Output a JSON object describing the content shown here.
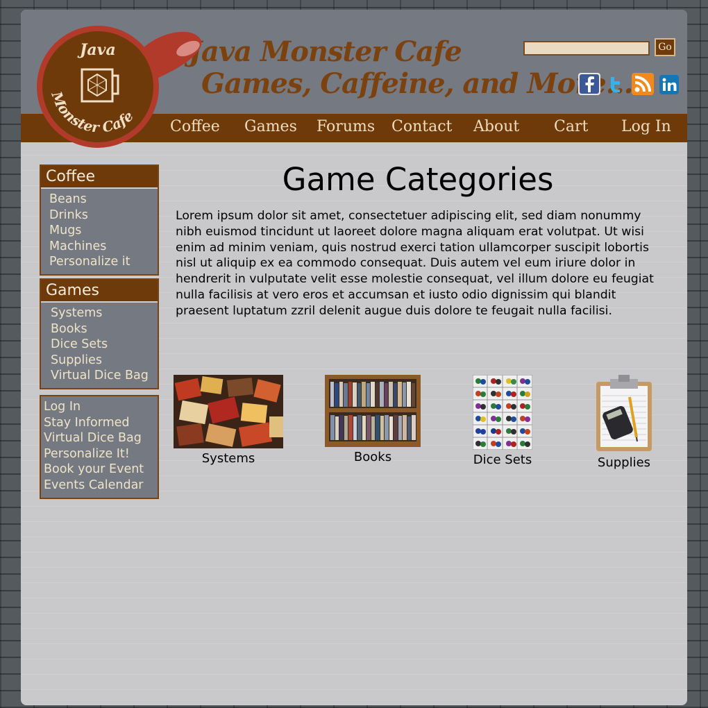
{
  "site": {
    "logo_text_top": "Java",
    "logo_text_bottom": "Monster Cafe",
    "title_line1": "Java Monster Cafe",
    "title_line2": "Games, Caffeine, and More..."
  },
  "search": {
    "placeholder": "",
    "value": "",
    "button_label": "Go"
  },
  "social": [
    "facebook-icon",
    "twitter-icon",
    "rss-icon",
    "linkedin-icon"
  ],
  "nav": [
    "Coffee",
    "Games",
    "Forums",
    "Contact",
    "About",
    "Cart",
    "Log In"
  ],
  "sidebar": {
    "coffee": {
      "heading": "Coffee",
      "items": [
        "Beans",
        "Drinks",
        "Mugs",
        "Machines",
        "Personalize it"
      ]
    },
    "games": {
      "heading": "Games",
      "items": [
        "Systems",
        "Books",
        "Dice Sets",
        "Supplies",
        "Virtual Dice Bag"
      ]
    },
    "links": [
      "Log In",
      "Stay Informed",
      "Virtual Dice Bag",
      "Personalize It!",
      "Book your Event",
      "Events Calendar"
    ]
  },
  "main": {
    "title": "Game Categories",
    "intro": "Lorem ipsum dolor sit amet, consectetuer adipiscing elit, sed diam nonummy nibh euismod tincidunt ut laoreet dolore magna aliquam erat volutpat. Ut wisi enim ad minim veniam, quis nostrud exerci tation ullamcorper suscipit lobortis nisl ut aliquip ex ea commodo consequat. Duis autem vel eum iriure dolor in hendrerit in vulputate velit esse molestie consequat, vel illum dolore eu feugiat nulla facilisis at vero eros et accumsan et iusto odio dignissim qui blandit praesent luptatum zzril delenit augue duis dolore te feugait nulla facilisi.",
    "categories": [
      "Systems",
      "Books",
      "Dice Sets",
      "Supplies"
    ]
  },
  "colors": {
    "brown": "#6e3a09",
    "header_gray": "#757981",
    "content_bg": "#c9c9cb",
    "logo_red": "#b23a2a"
  }
}
